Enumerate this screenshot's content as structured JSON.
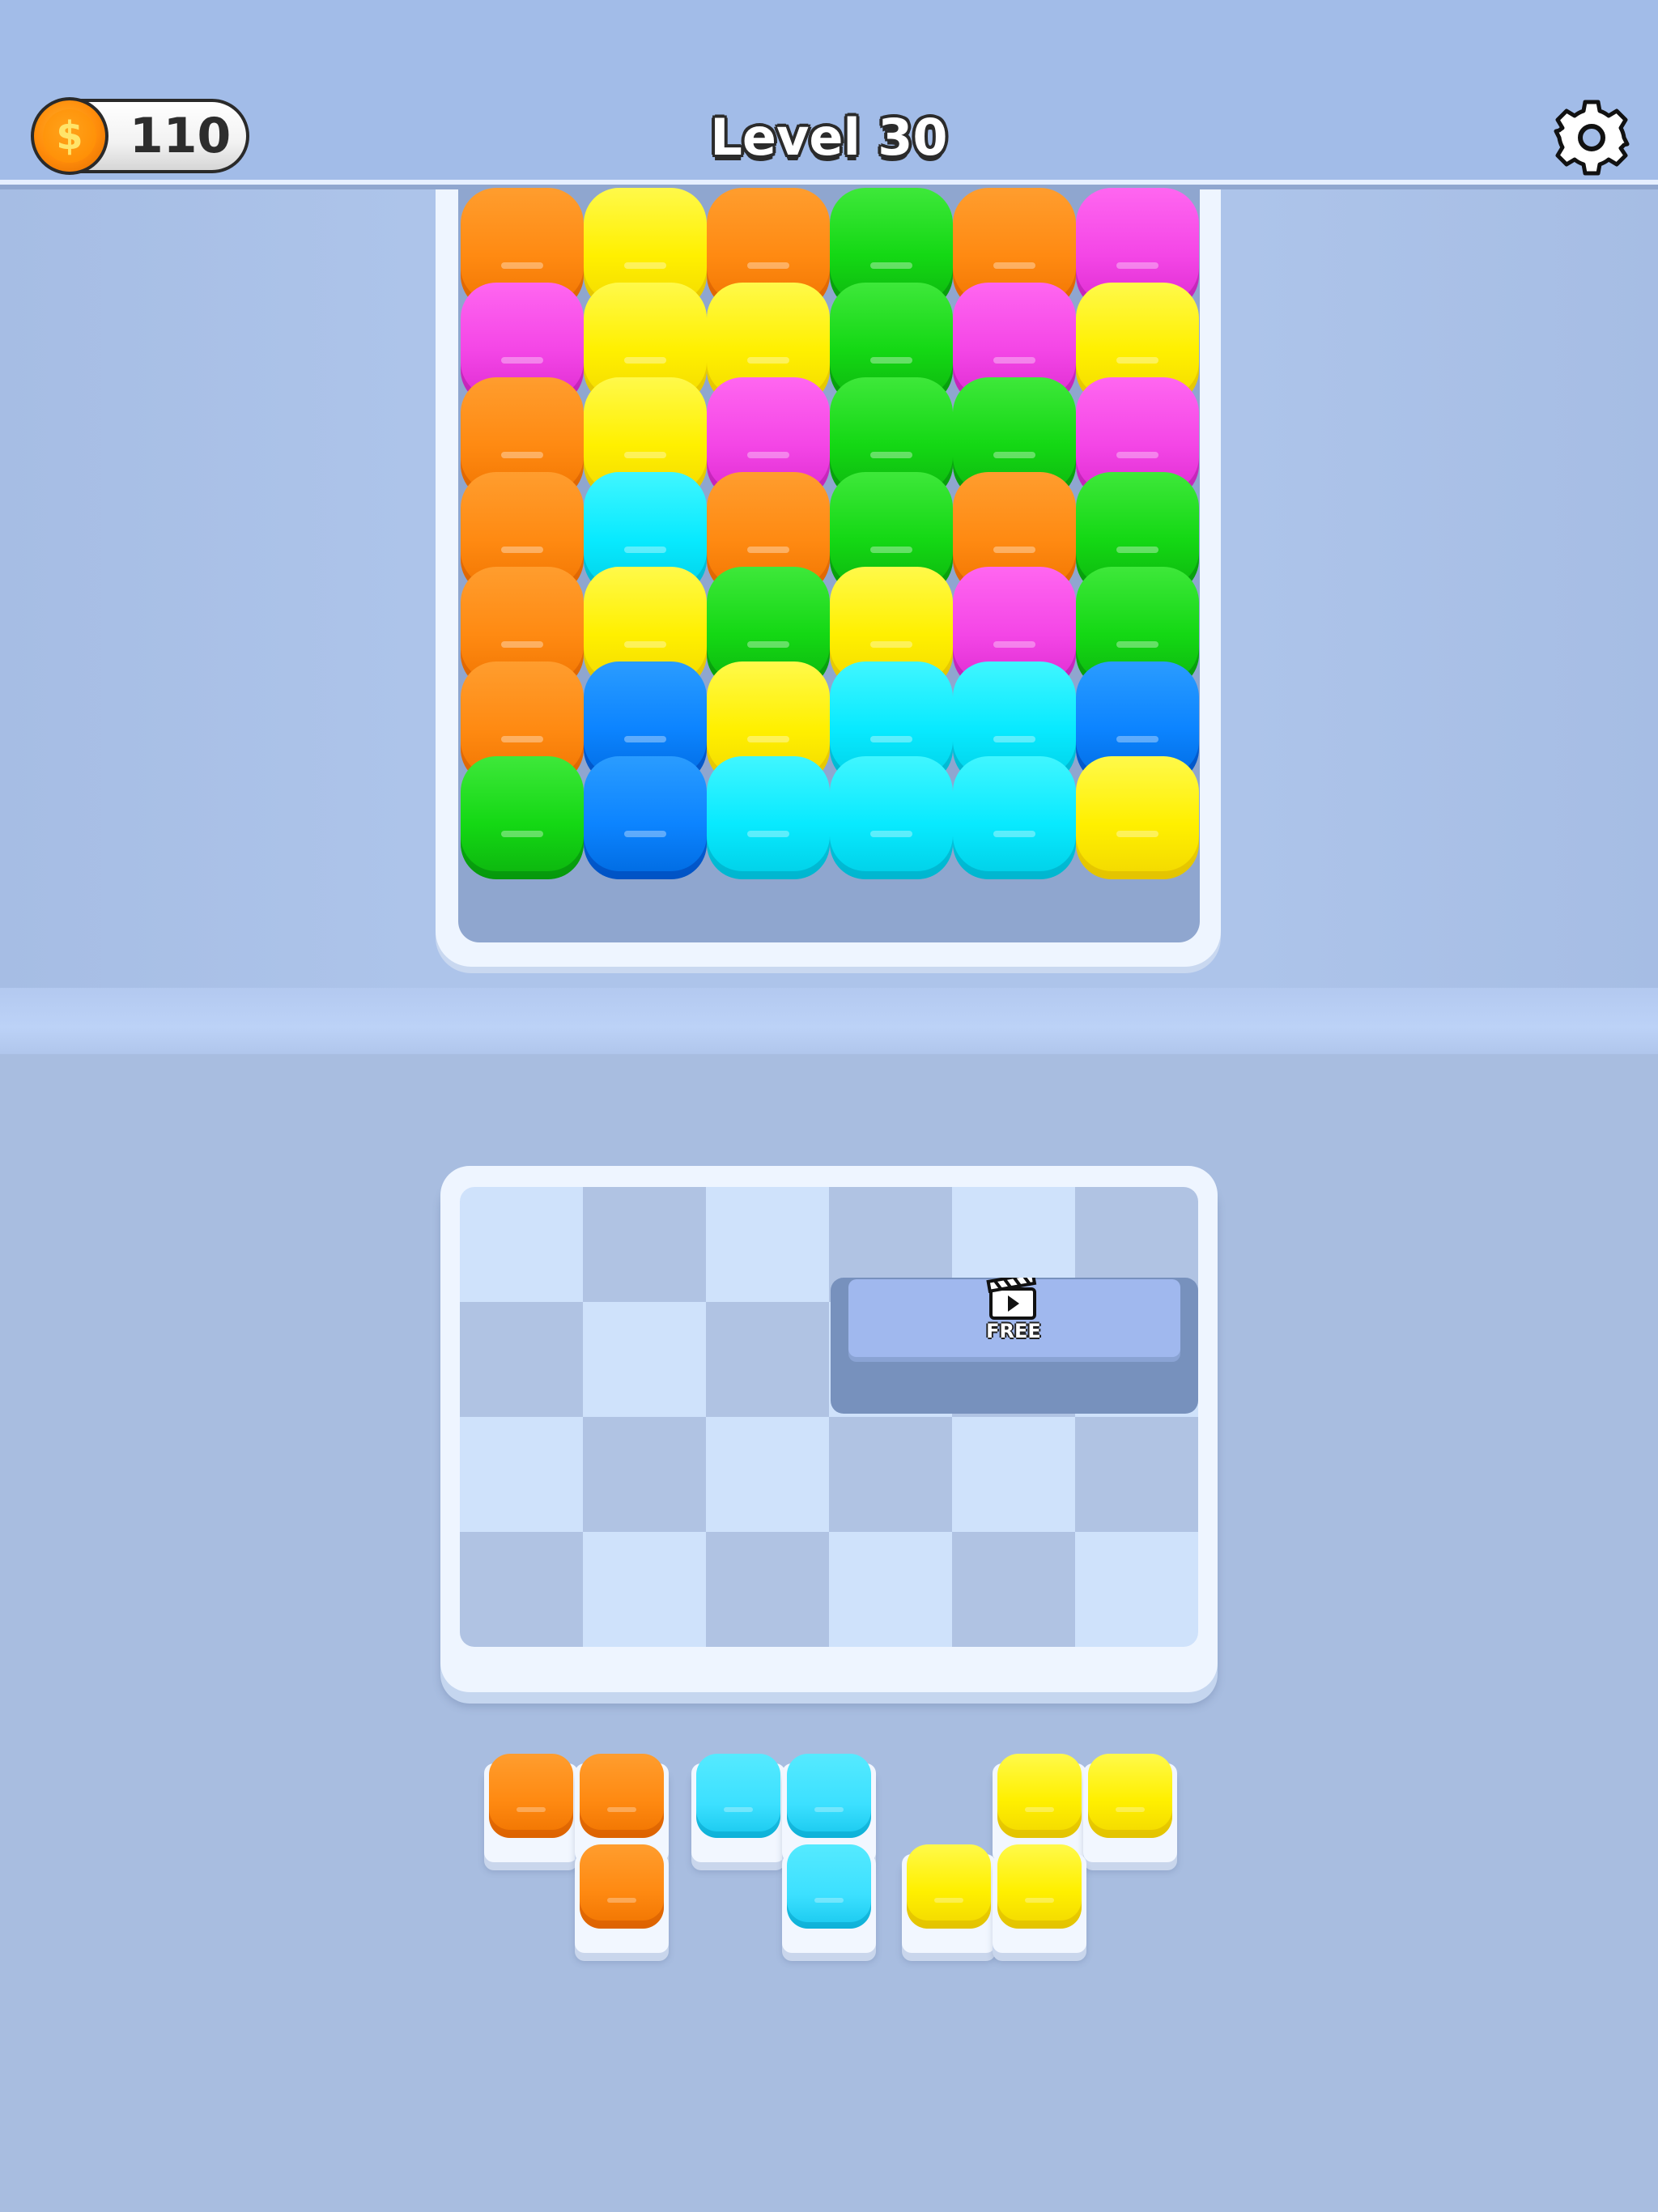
{
  "header": {
    "coins": "110",
    "coin_symbol": "$",
    "level_title": "Level 30",
    "settings_icon": "gear-icon"
  },
  "colors": {
    "orange": "#ff8a12",
    "yellow": "#fff000",
    "green": "#14d814",
    "magenta": "#f446e6",
    "cyan": "#08eaff",
    "blue": "#0c84ff"
  },
  "top_grid": {
    "columns": 6,
    "rows": [
      [
        "orange",
        "yellow",
        "orange",
        "green",
        "orange",
        "magenta"
      ],
      [
        "magenta",
        "yellow",
        "yellow",
        "green",
        "magenta",
        "yellow"
      ],
      [
        "orange",
        "yellow",
        "magenta",
        "green",
        "green",
        "magenta"
      ],
      [
        "orange",
        "cyan",
        "orange",
        "green",
        "orange",
        "green"
      ],
      [
        "orange",
        "yellow",
        "green",
        "yellow",
        "magenta",
        "green"
      ],
      [
        "orange",
        "blue",
        "yellow",
        "cyan",
        "cyan",
        "blue"
      ],
      [
        "green",
        "blue",
        "cyan",
        "cyan",
        "cyan",
        "yellow"
      ]
    ]
  },
  "board": {
    "columns": 6,
    "rows": 4,
    "free_slot": {
      "label": "FREE",
      "icon": "video-ad-icon"
    }
  },
  "pieces": [
    {
      "color": "orange",
      "cells": [
        [
          0,
          0
        ],
        [
          1,
          0
        ],
        [
          1,
          1
        ]
      ]
    },
    {
      "color": "cyan",
      "cells": [
        [
          0,
          0
        ],
        [
          1,
          0
        ],
        [
          1,
          1
        ]
      ]
    },
    {
      "color": "yellow",
      "cells": [
        [
          1,
          0
        ],
        [
          2,
          0
        ],
        [
          0,
          1
        ],
        [
          1,
          1
        ]
      ]
    }
  ]
}
